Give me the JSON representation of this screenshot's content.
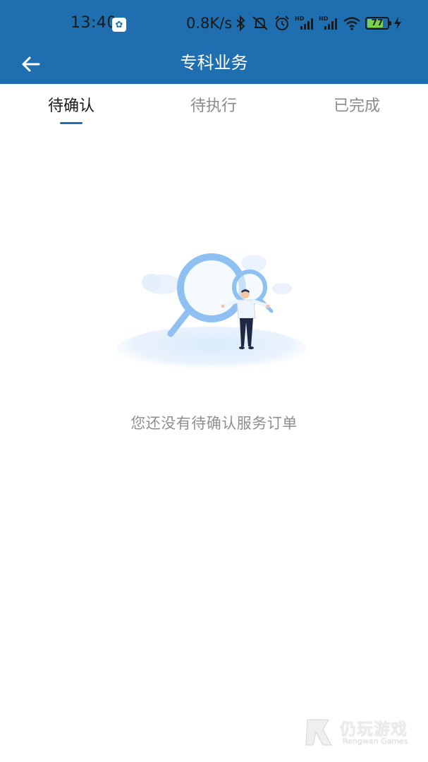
{
  "status_bar": {
    "time": "13:40",
    "app_badge_icon": "gear-icon",
    "net_speed": "0.8K/s",
    "icons": [
      "bluetooth-icon",
      "mute-icon",
      "alarm-icon",
      "signal-hd-icon",
      "signal-hd-icon",
      "wifi-icon",
      "battery-icon",
      "charging-icon"
    ],
    "battery_level": "77",
    "battery_fraction": 0.77
  },
  "app_bar": {
    "back_icon": "arrow-left-icon",
    "title": "专科业务",
    "background": "#1f6fb0"
  },
  "tabs": [
    {
      "label": "待确认",
      "active": true
    },
    {
      "label": "待执行",
      "active": false
    },
    {
      "label": "已完成",
      "active": false
    }
  ],
  "empty_state": {
    "illustration": "magnifier-person-illustration",
    "message": "您还没有待确认服务订单"
  },
  "watermark": {
    "title": "仍玩游戏",
    "subtitle": "Rengwan Games"
  },
  "colors": {
    "accent": "#1f6fb0",
    "tab_active_text": "#1a1a1a",
    "tab_inactive_text": "#8a8a8a",
    "empty_text": "#8f8f8f"
  }
}
